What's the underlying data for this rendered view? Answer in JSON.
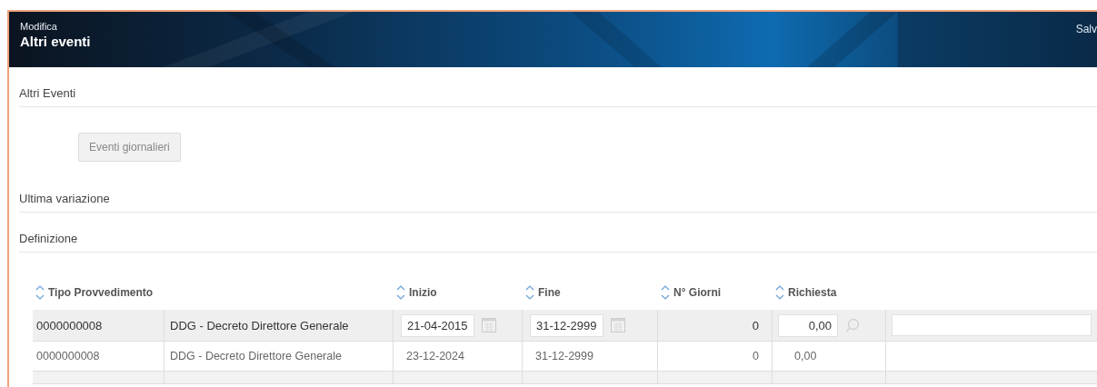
{
  "header": {
    "subtitle": "Modifica",
    "title": "Altri eventi",
    "action": "Salv"
  },
  "sections": [
    {
      "title": "Altri Eventi",
      "buttons": [
        "Eventi giornalieri"
      ]
    },
    {
      "title": "Ultima variazione"
    },
    {
      "title": "Definizione"
    }
  ],
  "table": {
    "columns": [
      {
        "label": "Tipo Provvedimento"
      },
      {
        "label": "Inizio"
      },
      {
        "label": "Fine"
      },
      {
        "label": "N° Giorni"
      },
      {
        "label": "Richiesta"
      }
    ],
    "rows": [
      {
        "kind": "edit",
        "code": "0000000008",
        "type": "DDG - Decreto Direttore Generale",
        "start": "21-04-2015",
        "end": "31-12-2999",
        "days": "0",
        "request": "0,00",
        "note": ""
      },
      {
        "kind": "view",
        "code": "0000000008",
        "type": "DDG - Decreto Direttore Generale",
        "start": "23-12-2024",
        "end": "31-12-2999",
        "days": "0",
        "request": "0,00"
      },
      {
        "kind": "empty"
      }
    ]
  }
}
